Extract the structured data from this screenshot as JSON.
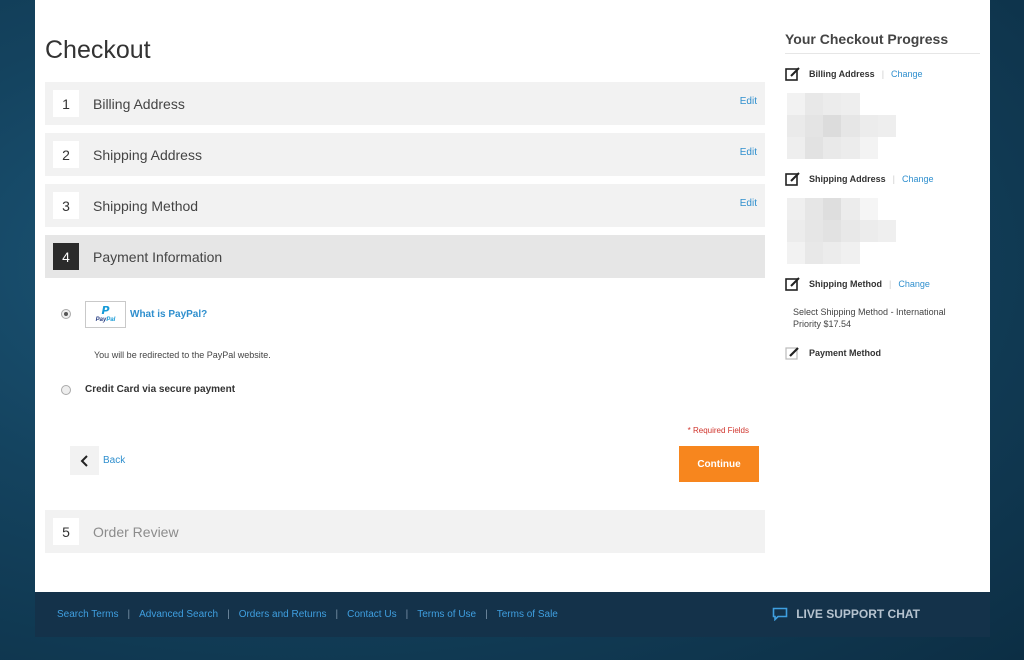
{
  "checkout": {
    "title": "Checkout",
    "steps": [
      {
        "num": "1",
        "label": "Billing Address",
        "edit": "Edit"
      },
      {
        "num": "2",
        "label": "Shipping Address",
        "edit": "Edit"
      },
      {
        "num": "3",
        "label": "Shipping Method",
        "edit": "Edit"
      },
      {
        "num": "4",
        "label": "Payment Information"
      },
      {
        "num": "5",
        "label": "Order Review"
      }
    ],
    "payment": {
      "paypal_logo_p": "P",
      "paypal_logo_word_a": "Pay",
      "paypal_logo_word_b": "Pal",
      "what_is_paypal": "What is PayPal?",
      "redirect_note": "You will be redirected to the PayPal website.",
      "credit_card_label": "Credit Card via secure payment",
      "required_fields": "* Required Fields",
      "back_label": "Back",
      "continue_label": "Continue"
    }
  },
  "progress": {
    "title": "Your Checkout Progress",
    "change_label": "Change",
    "sections": [
      {
        "label": "Billing Address"
      },
      {
        "label": "Shipping Address"
      },
      {
        "label": "Shipping Method",
        "text": "Select Shipping Method - International Priority $17.54"
      },
      {
        "label": "Payment Method"
      }
    ]
  },
  "footer": {
    "links": [
      "Search Terms",
      "Advanced Search",
      "Orders and Returns",
      "Contact Us",
      "Terms of Use",
      "Terms of Sale"
    ],
    "separator": "|",
    "chat_label": "LIVE SUPPORT CHAT"
  },
  "colors": {
    "accent": "#f7861e",
    "link": "#2f8fce",
    "required": "#d0342c",
    "footer_bg": "#14324a"
  }
}
